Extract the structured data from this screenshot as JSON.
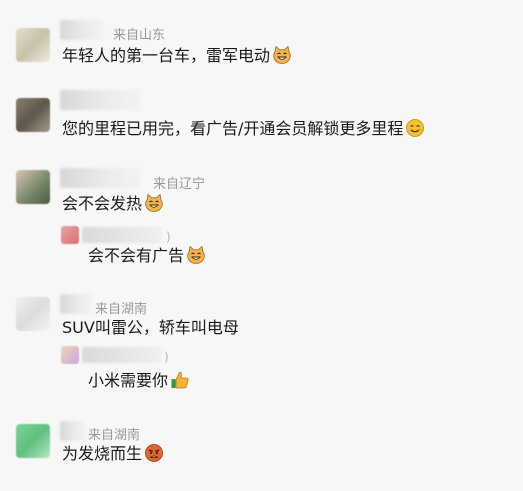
{
  "comments": [
    {
      "location": "来自山东",
      "text": "年轻人的第一台车，雷军电动",
      "emoji": "cat-grin-icon"
    },
    {
      "location": "",
      "text": "您的里程已用完，看广告/开通会员解锁更多里程",
      "emoji": "smile-face-icon"
    },
    {
      "location": "来自辽宁",
      "text": "会不会发热",
      "emoji": "cat-grin-icon",
      "reply": {
        "suffix": ")",
        "text": "会不会有广告",
        "emoji": "cat-grin-icon"
      }
    },
    {
      "location": "来自湖南",
      "text": "SUV叫雷公，轿车叫电母",
      "reply": {
        "suffix": ")",
        "text": "小米需要你",
        "emoji": "thumbs-up-icon"
      }
    },
    {
      "location": "来自湖南",
      "text": "为发烧而生",
      "emoji": "angry-face-icon"
    }
  ]
}
